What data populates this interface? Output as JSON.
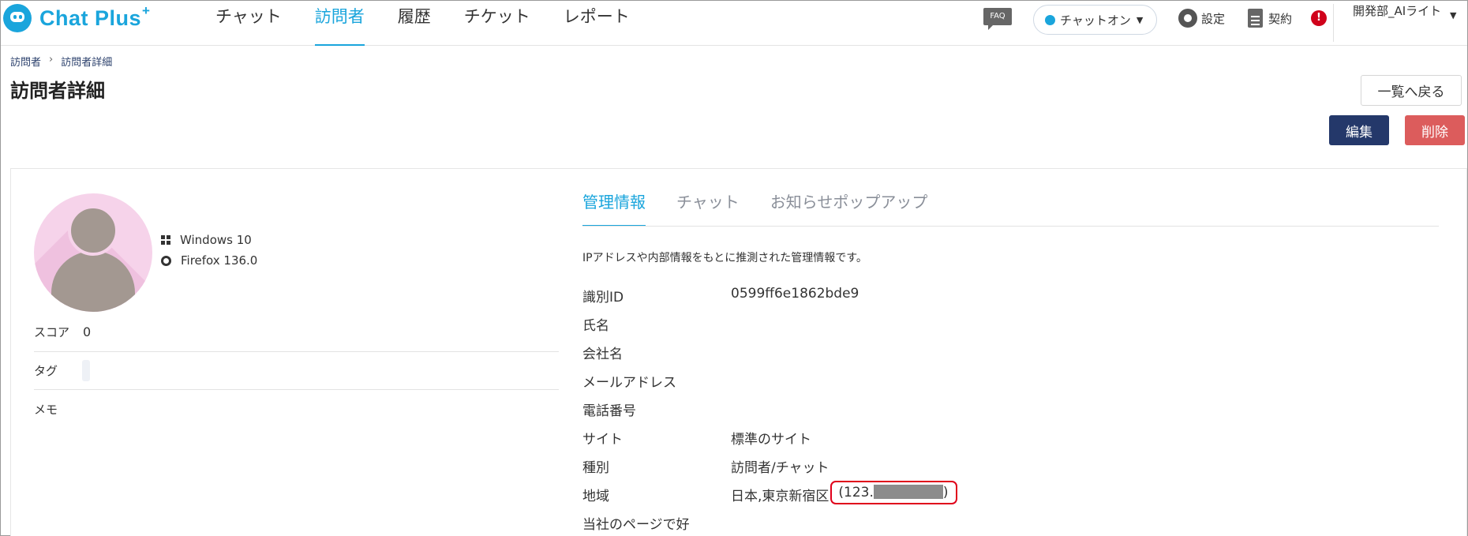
{
  "header": {
    "logo_text": "Chat Plus",
    "logo_sup": "+",
    "nav": [
      "チャット",
      "訪問者",
      "履歴",
      "チケット",
      "レポート"
    ],
    "nav_active": 1,
    "faq_label": "FAQ",
    "chat_status": "チャットオン",
    "settings_label": "設定",
    "contract_label": "契約",
    "alert_label": "!",
    "user_name": "開発部_AIライト"
  },
  "breadcrumb": {
    "root": "訪問者",
    "separator": "›",
    "current": "訪問者詳細"
  },
  "page": {
    "title": "訪問者詳細",
    "back_button": "一覧へ戻る",
    "edit_button": "編集",
    "delete_button": "削除"
  },
  "visitor": {
    "os": "Windows 10",
    "browser": "Firefox 136.0",
    "score_label": "スコア",
    "score_value": "0",
    "tag_label": "タグ",
    "memo_label": "メモ"
  },
  "tabs": [
    "管理情報",
    "チャット",
    "お知らせポップアップ"
  ],
  "tab_active": 0,
  "info": {
    "note": "IPアドレスや内部情報をもとに推測された管理情報です。",
    "fields": [
      {
        "label": "識別ID",
        "value": "0599ff6e1862bde9"
      },
      {
        "label": "氏名",
        "value": ""
      },
      {
        "label": "会社名",
        "value": ""
      },
      {
        "label": "メールアドレス",
        "value": ""
      },
      {
        "label": "電話番号",
        "value": ""
      },
      {
        "label": "サイト",
        "value": "標準のサイト"
      },
      {
        "label": "種別",
        "value": "訪問者/チャット"
      },
      {
        "label": "地域",
        "value": "日本,東京新宿区"
      },
      {
        "label": "当社のページで好",
        "value": ""
      }
    ],
    "ip_prefix": "(123.",
    "ip_suffix": ")"
  },
  "colors": {
    "accent": "#1aa5dc",
    "edit_button": "#24386a",
    "delete_button": "#dc5c5c",
    "highlight": "#e0001b"
  }
}
